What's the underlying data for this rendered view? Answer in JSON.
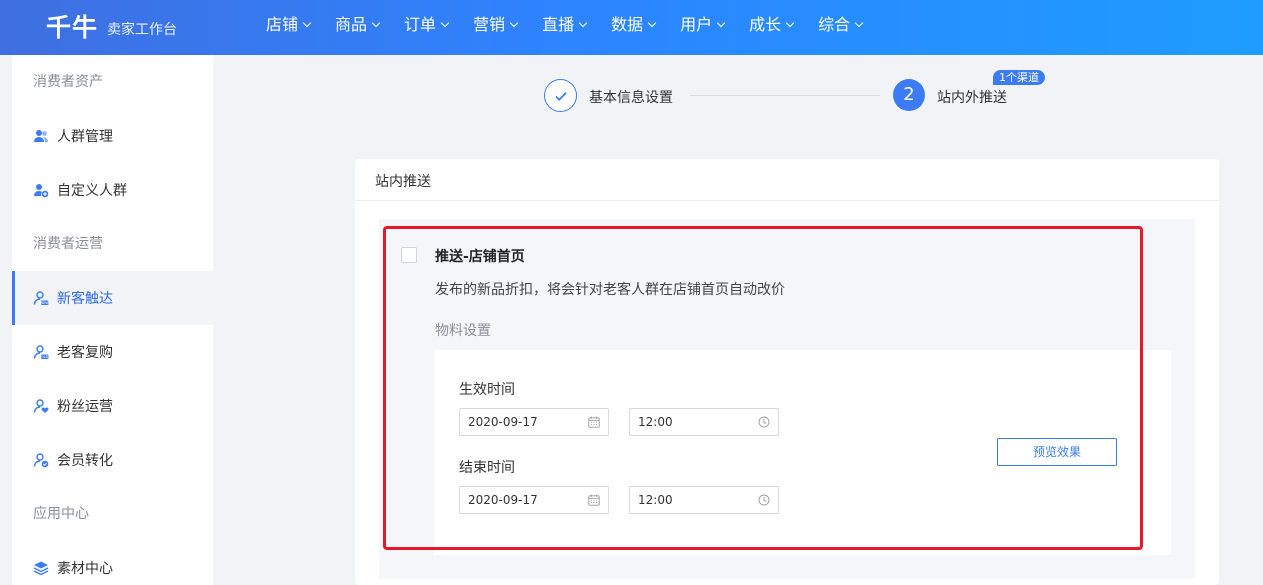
{
  "header": {
    "logo": "千牛",
    "subtitle": "卖家工作台",
    "nav": [
      "店铺",
      "商品",
      "订单",
      "营销",
      "直播",
      "数据",
      "用户",
      "成长",
      "综合"
    ]
  },
  "sidebar": {
    "section1": "消费者资产",
    "item_people": "人群管理",
    "item_custom": "自定义人群",
    "section2": "消费者运营",
    "item_new": "新客触达",
    "item_repeat": "老客复购",
    "item_fans": "粉丝运营",
    "item_member": "会员转化",
    "section3": "应用中心",
    "item_material": "素材中心"
  },
  "steps": {
    "step1_label": "基本信息设置",
    "step2_number": "2",
    "step2_label": "站内外推送",
    "step2_badge": "1个渠道"
  },
  "card": {
    "title": "站内推送",
    "push_title": "推送-店铺首页",
    "push_desc": "发布的新品折扣，将会针对老客人群在店铺首页自动改价",
    "material_label": "物料设置",
    "start_label": "生效时间",
    "start_date": "2020-09-17",
    "start_time": "12:00",
    "end_label": "结束时间",
    "end_date": "2020-09-17",
    "end_time": "12:00",
    "preview_button": "预览效果"
  },
  "colors": {
    "accent": "#3b7cf6",
    "highlight": "#e5192a"
  }
}
